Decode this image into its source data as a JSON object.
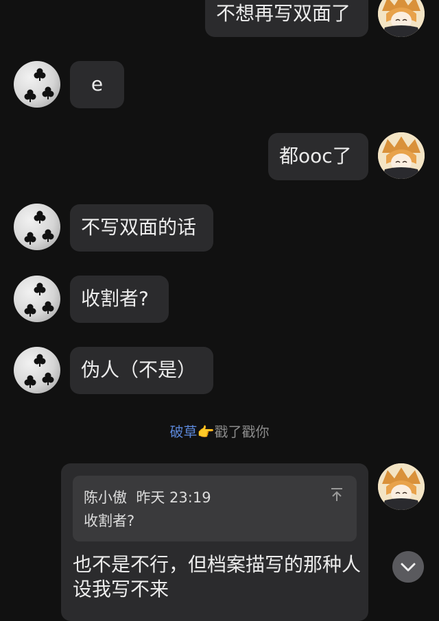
{
  "messages": [
    {
      "side": "right",
      "text": "不想再写双面了"
    },
    {
      "side": "left",
      "text": "e"
    },
    {
      "side": "right",
      "text": "都ooc了"
    },
    {
      "side": "left",
      "text": "不写双面的话"
    },
    {
      "side": "left",
      "text": "收割者?"
    },
    {
      "side": "left",
      "text": "伪人（不是）"
    }
  ],
  "poke": {
    "name": "破草",
    "emoji": "👉",
    "action": "戳了戳你"
  },
  "reply": {
    "quote_author": "陈小傲",
    "quote_time": "昨天 23:19",
    "quote_text": "收割者?",
    "text": "也不是不行，但档案描写的那种人设我写不来"
  },
  "icons": {
    "left_avatar": "clubs-avatar-icon",
    "right_avatar": "anime-girl-avatar-icon",
    "scroll": "chevron-down-icon",
    "quote": "scroll-to-top-icon"
  },
  "colors": {
    "background": "#111111",
    "bubble": "#2b2b2d",
    "quote": "#3a3a3c",
    "poke_name": "#5b86d6"
  }
}
